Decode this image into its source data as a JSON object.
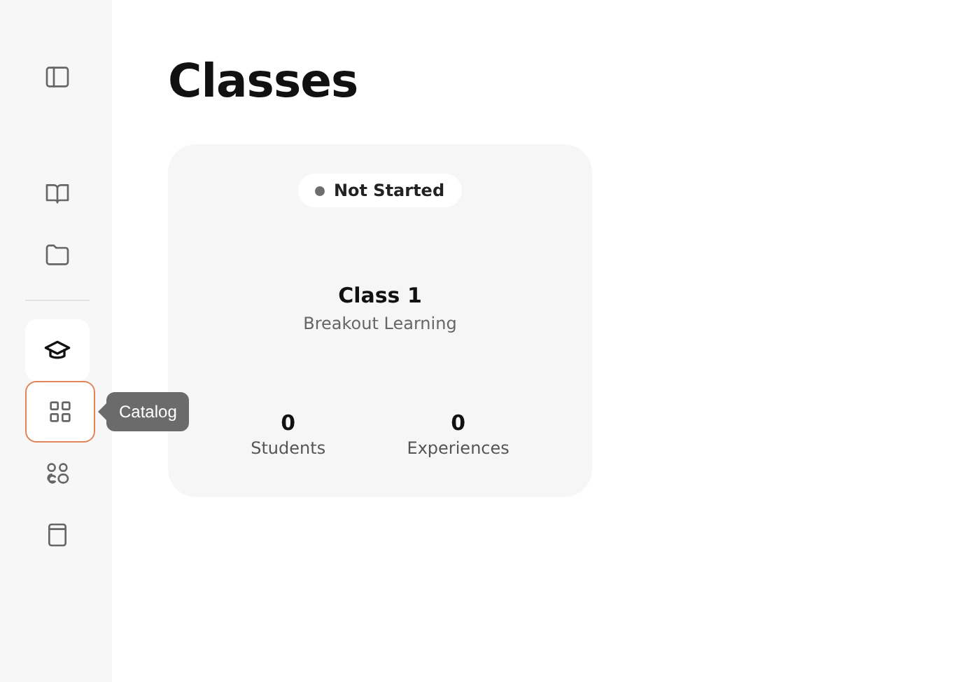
{
  "sidebar": {
    "toggle": {
      "kind": "panel"
    },
    "groups": [
      [
        {
          "kind": "book",
          "selected": false,
          "focused": false
        },
        {
          "kind": "folder",
          "selected": false,
          "focused": false
        }
      ],
      [
        {
          "kind": "cap",
          "selected": true,
          "focused": false
        },
        {
          "kind": "grid",
          "selected": false,
          "focused": true,
          "tooltip": "Catalog"
        },
        {
          "kind": "people",
          "selected": false,
          "focused": false
        },
        {
          "kind": "notebook",
          "selected": false,
          "focused": false
        }
      ]
    ]
  },
  "page": {
    "title": "Classes",
    "cards": [
      {
        "status": {
          "label": "Not Started",
          "color": "#6e6e6e"
        },
        "title": "Class 1",
        "subtitle": "Breakout Learning",
        "stats": [
          {
            "value": "0",
            "label": "Students"
          },
          {
            "value": "0",
            "label": "Experiences"
          }
        ]
      }
    ]
  }
}
